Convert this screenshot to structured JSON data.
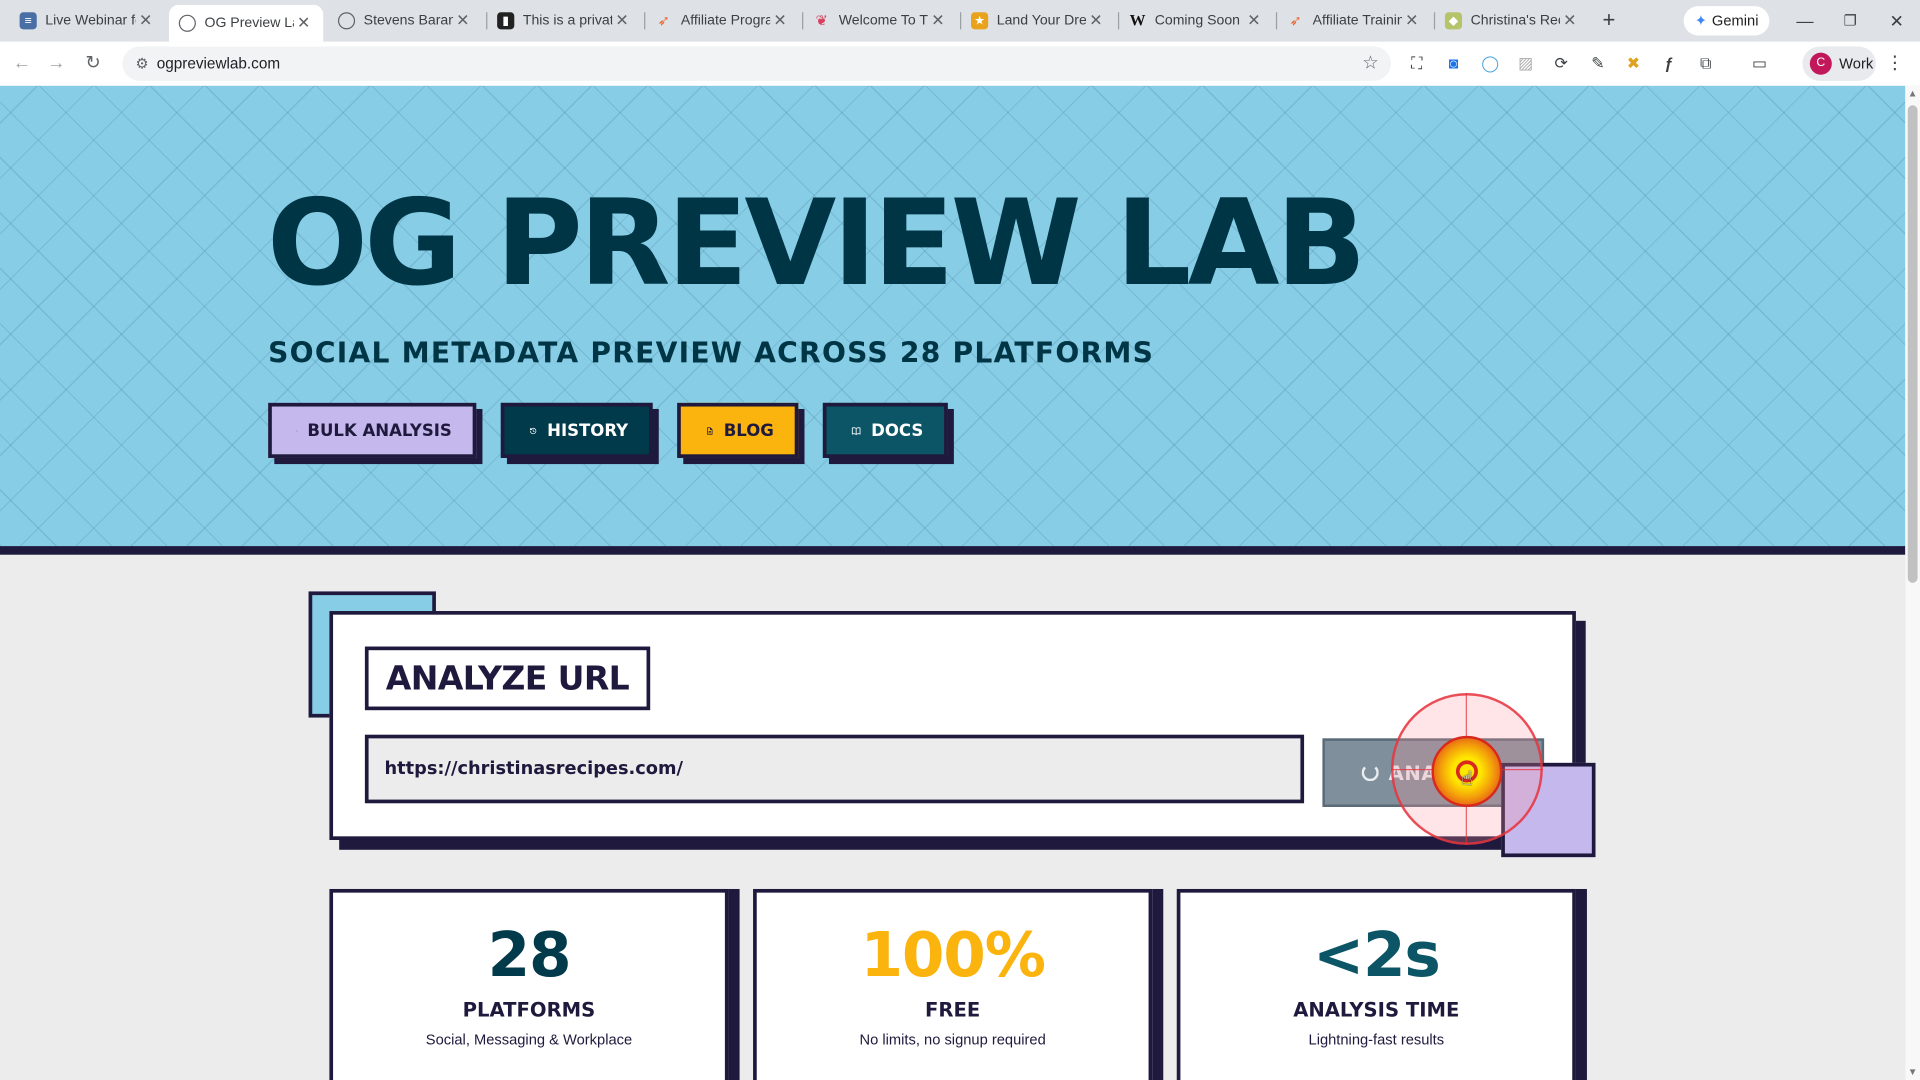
{
  "browser": {
    "tabs": [
      {
        "title": "Live Webinar for",
        "icon": "grid-icon",
        "color": "#4a6fa5"
      },
      {
        "title": "OG Preview Lab",
        "icon": "globe-icon",
        "color": "#5f6368"
      },
      {
        "title": "Stevens Baranik",
        "icon": "globe-icon",
        "color": "#5f6368"
      },
      {
        "title": "This is a private",
        "icon": "site-icon",
        "color": "#222222"
      },
      {
        "title": "Affiliate Progran",
        "icon": "rocket-icon",
        "color": "#e8632b"
      },
      {
        "title": "Welcome To The",
        "icon": "leaf-icon",
        "color": "#d93f5c"
      },
      {
        "title": "Land Your Drean",
        "icon": "star-icon",
        "color": "#e9a21b"
      },
      {
        "title": "Coming Soon - §",
        "icon": "wikipedia-icon",
        "color": "#111111"
      },
      {
        "title": "Affiliate Training",
        "icon": "rocket-icon",
        "color": "#e8632b"
      },
      {
        "title": "Christina's Recip",
        "icon": "recipe-icon",
        "color": "#b5c36b"
      }
    ],
    "new_tab_label": "+",
    "gemini_label": "Gemini",
    "url": "ogpreviewlab.com",
    "profile_initial": "C",
    "profile_label": "Work"
  },
  "hero": {
    "title": "OG PREVIEW LAB",
    "subtitle": "SOCIAL METADATA PREVIEW ACROSS 28 PLATFORMS",
    "buttons": [
      {
        "label": "BULK ANALYSIS",
        "icon": "layers-icon"
      },
      {
        "label": "HISTORY",
        "icon": "history-icon"
      },
      {
        "label": "BLOG",
        "icon": "document-icon"
      },
      {
        "label": "DOCS",
        "icon": "book-icon"
      }
    ]
  },
  "analyze": {
    "heading": "ANALYZE URL",
    "input_value": "https://christinasrecipes.com/",
    "button_label": "ANALYZING"
  },
  "stats": [
    {
      "value": "28",
      "label": "PLATFORMS",
      "desc": "Social, Messaging & Workplace",
      "color": "#013a4a"
    },
    {
      "value": "100%",
      "label": "FREE",
      "desc": "No limits, no signup required",
      "color": "#fbb30d"
    },
    {
      "value": "<2s",
      "label": "ANALYSIS TIME",
      "desc": "Lightning-fast results",
      "color": "#0b5567"
    }
  ]
}
